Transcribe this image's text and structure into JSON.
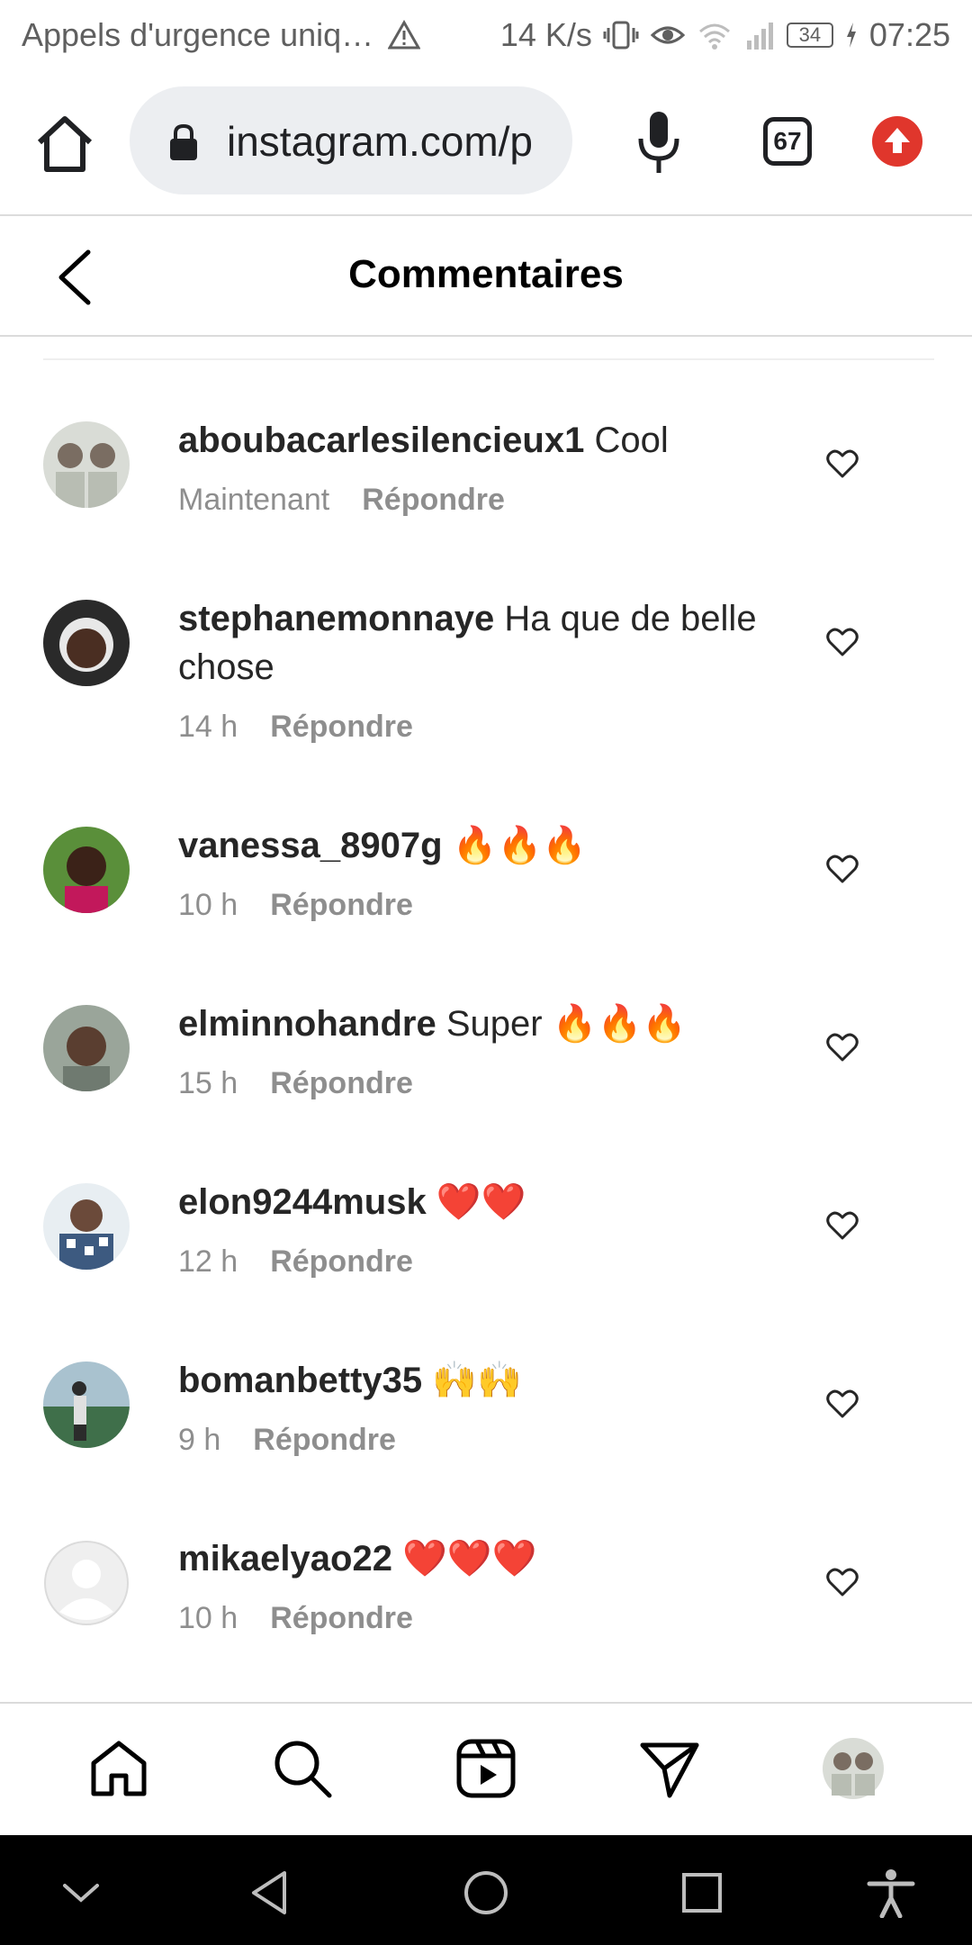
{
  "status_bar": {
    "carrier_text": "Appels d'urgence uniq…",
    "network_speed": "14 K/s",
    "battery": "34",
    "time": "07:25"
  },
  "browser": {
    "url": "instagram.com/p",
    "tab_count": "67"
  },
  "header": {
    "title": "Commentaires"
  },
  "comments": [
    {
      "username": "aboubacarlesilencieux1",
      "text": "Cool",
      "time": "Maintenant",
      "reply": "Répondre"
    },
    {
      "username": "stephanemonnaye",
      "text": "Ha que de belle chose",
      "time": "14 h",
      "reply": "Répondre"
    },
    {
      "username": "vanessa_8907g",
      "text": "🔥🔥🔥",
      "time": "10 h",
      "reply": "Répondre"
    },
    {
      "username": "elminnohandre",
      "text": "Super 🔥🔥🔥",
      "time": "15 h",
      "reply": "Répondre"
    },
    {
      "username": "elon9244musk",
      "text": "❤️❤️",
      "time": "12 h",
      "reply": "Répondre"
    },
    {
      "username": "bomanbetty35",
      "text": "🙌🙌",
      "time": "9 h",
      "reply": "Répondre"
    },
    {
      "username": "mikaelyao22",
      "text": "❤️❤️❤️",
      "time": "10 h",
      "reply": "Répondre"
    }
  ],
  "colors": {
    "accent_red": "#e0362c",
    "text_primary": "#262626",
    "text_secondary": "#8e8e8e"
  }
}
